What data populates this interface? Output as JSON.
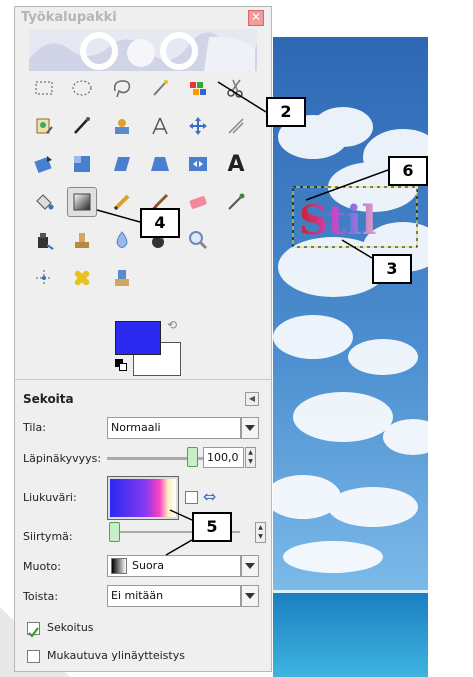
{
  "window": {
    "title": "Työkalupakki"
  },
  "options": {
    "section_title": "Sekoita",
    "mode": {
      "label": "Tila:",
      "value": "Normaali"
    },
    "opacity": {
      "label": "Läpinäkyvyys:",
      "value": "100,0",
      "level": 1.0
    },
    "gradient": {
      "label": "Liukuväri:"
    },
    "offset": {
      "label": "Siirtymä:"
    },
    "shape": {
      "label": "Muoto:",
      "value": "Suora"
    },
    "repeat": {
      "label": "Toista:",
      "value": "Ei mitään"
    },
    "dither": {
      "label": "Sekoitus",
      "checked": true
    },
    "supersampling": {
      "label": "Mukautuva ylinäytteistys",
      "checked": false
    }
  },
  "canvas": {
    "text": "Stil"
  },
  "callouts": [
    "2",
    "6",
    "4",
    "3",
    "5"
  ],
  "colors": {
    "foreground": "#2a2af0",
    "background": "#ffffff",
    "accent_red": "#cc1111",
    "sky": "#3d7fc4"
  }
}
